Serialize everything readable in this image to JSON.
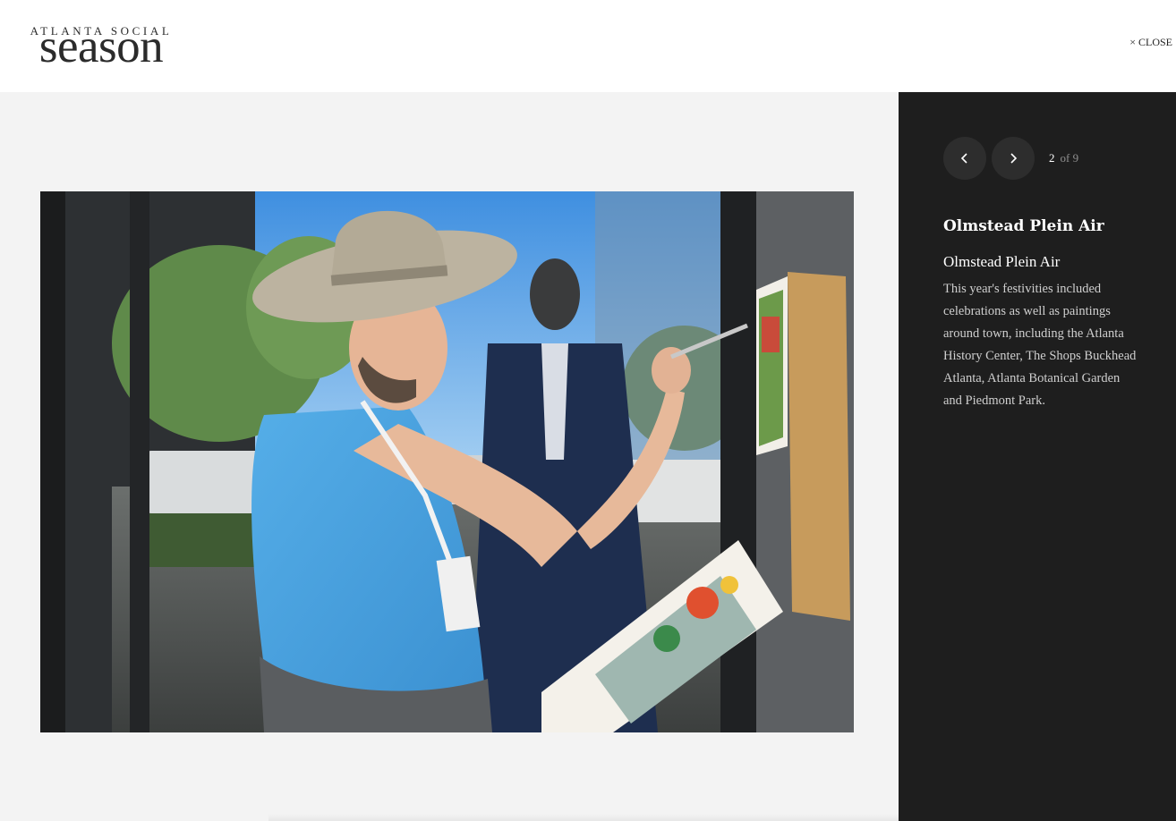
{
  "header": {
    "logo_top": "ATLANTA SOCIAL",
    "logo_main": "season",
    "close_label": "CLOSE",
    "close_icon": "×"
  },
  "gallery": {
    "image_alt": "Artist in a wide-brim hat painting at an easel in front of a storefront window",
    "current": "2",
    "total_label": "of 9",
    "prev_icon": "chevron-left-icon",
    "next_icon": "chevron-right-icon"
  },
  "caption": {
    "title": "Olmstead Plein Air",
    "subtitle": "Olmstead Plein Air",
    "body": "This year's festivities included celebrations as well as paintings around town, including the Atlanta History Center, The Shops Buckhead Atlanta, Atlanta Botanical Garden and Piedmont Park."
  },
  "colors": {
    "sidebar_bg": "#1e1e1e",
    "stage_bg": "#f3f3f3",
    "nav_button_bg": "#2d2d2d"
  }
}
